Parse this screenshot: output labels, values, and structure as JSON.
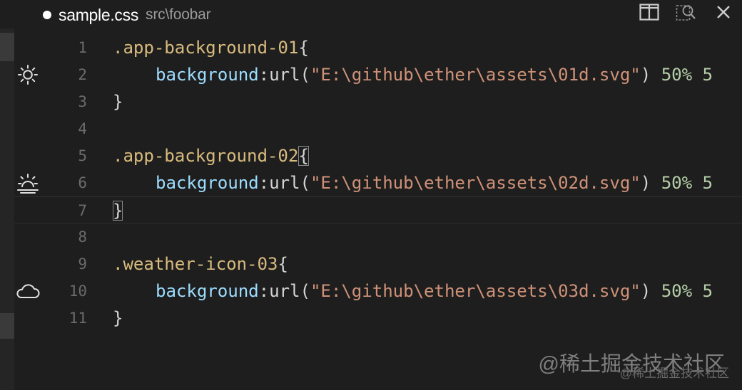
{
  "tab": {
    "file_name": "sample.css",
    "path": "src\\foobar"
  },
  "title_actions": [
    {
      "name": "split-editor-icon"
    },
    {
      "name": "open-preview-icon"
    },
    {
      "name": "close-icon"
    }
  ],
  "gutter_icons": [
    {
      "line": 2,
      "name": "sun-icon"
    },
    {
      "line": 6,
      "name": "sunrise-icon"
    },
    {
      "line": 10,
      "name": "cloud-icon"
    }
  ],
  "line_numbers": [
    "1",
    "2",
    "3",
    "4",
    "5",
    "6",
    "7",
    "8",
    "9",
    "10",
    "11"
  ],
  "code": {
    "block1": {
      "selector": ".app-background-01",
      "open": "{",
      "property": "background",
      "colon": ":",
      "func": "url(",
      "string": "\"E:\\github\\ether\\assets\\01d.svg\"",
      "close_paren": ")",
      "pos1": "50%",
      "pos2_partial": "5",
      "close": "}"
    },
    "block2": {
      "selector": ".app-background-02",
      "open": "{",
      "property": "background",
      "colon": ":",
      "func": "url(",
      "string": "\"E:\\github\\ether\\assets\\02d.svg\"",
      "close_paren": ")",
      "pos1": "50%",
      "pos2_partial": "5",
      "close": "}"
    },
    "block3": {
      "selector": ".weather-icon-03",
      "open": "{",
      "property": "background",
      "colon": ":",
      "func": "url(",
      "string": "\"E:\\github\\ether\\assets\\03d.svg\"",
      "close_paren": ")",
      "pos1": "50%",
      "pos2_partial": "5",
      "close": "}"
    }
  },
  "watermark": {
    "main": "@稀土掘金技术社区",
    "small": "@稀土掘金技术社区"
  },
  "colors": {
    "background": "#1e1e1e",
    "selector": "#d7ba7d",
    "property": "#9cdcfe",
    "string": "#ce9178",
    "number": "#b5cea8",
    "line_number": "#6b6b6b"
  }
}
